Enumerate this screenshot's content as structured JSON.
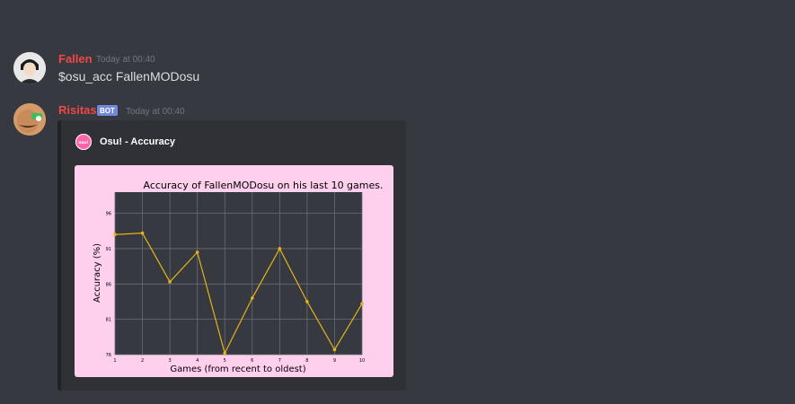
{
  "messages": [
    {
      "author": "Fallen",
      "author_color": "#f04747",
      "timestamp": "Today at 00:40",
      "content": "$osu_acc FallenMODosu"
    },
    {
      "author": "Risitas",
      "author_color": "#f04747",
      "badge": "BOT",
      "timestamp": "Today at 00:40",
      "embed": {
        "author_name": "Osu! - Accuracy",
        "author_icon_text": "osu!",
        "chart_data": {
          "type": "line",
          "title": "Accuracy of FallenMODosu on his last 10 games.",
          "xlabel": "Games (from recent to oldest)",
          "ylabel": "Accuracy (%)",
          "x": [
            1,
            2,
            3,
            4,
            5,
            6,
            7,
            8,
            9,
            10
          ],
          "y": [
            93.0,
            93.2,
            86.3,
            90.5,
            76.2,
            84.0,
            91.0,
            83.5,
            76.7,
            83.2
          ],
          "xticks": [
            "1",
            "2",
            "3",
            "4",
            "5",
            "6",
            "7",
            "8",
            "9",
            "10"
          ],
          "yticks": [
            "76",
            "81",
            "86",
            "91",
            "96"
          ],
          "xlim": [
            1,
            10
          ],
          "ylim": [
            76,
            99
          ],
          "grid": true,
          "line_color": "#e5b31a",
          "plot_bg": "#36393f",
          "figure_bg": "#ffd0ee"
        }
      }
    }
  ]
}
